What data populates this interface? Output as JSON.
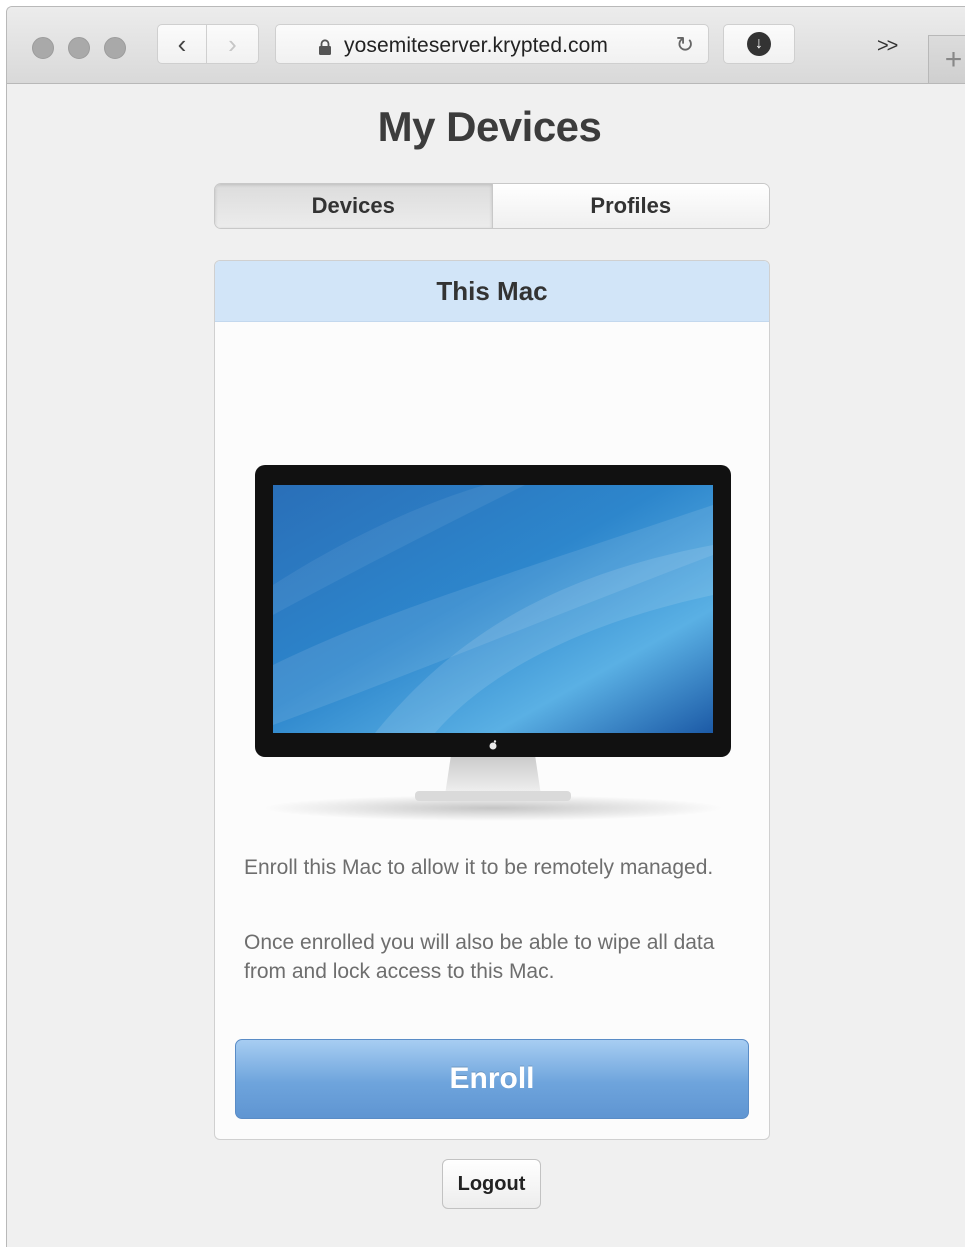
{
  "browser": {
    "url": "yosemiteserver.krypted.com",
    "back_glyph": "‹",
    "forward_glyph": "›",
    "reload_glyph": "↻",
    "download_glyph": "↓",
    "overflow_glyph": ">>",
    "newtab_glyph": "+"
  },
  "page": {
    "title": "My Devices",
    "tabs": [
      {
        "label": "Devices",
        "active": true
      },
      {
        "label": "Profiles",
        "active": false
      }
    ],
    "card": {
      "header": "This Mac",
      "paragraph1": "Enroll this Mac to allow it to be remotely managed.",
      "paragraph2": "Once enrolled you will also be able to wipe all data from and lock access to this Mac.",
      "enroll_label": "Enroll"
    },
    "logout_label": "Logout"
  },
  "colors": {
    "card_header_bg": "#d2e5f8",
    "enroll_button": "#6ea4dc",
    "title_text": "#3c3c3c"
  },
  "icons": [
    "lock-icon",
    "reload-icon",
    "download-icon",
    "apple-logo-icon"
  ]
}
